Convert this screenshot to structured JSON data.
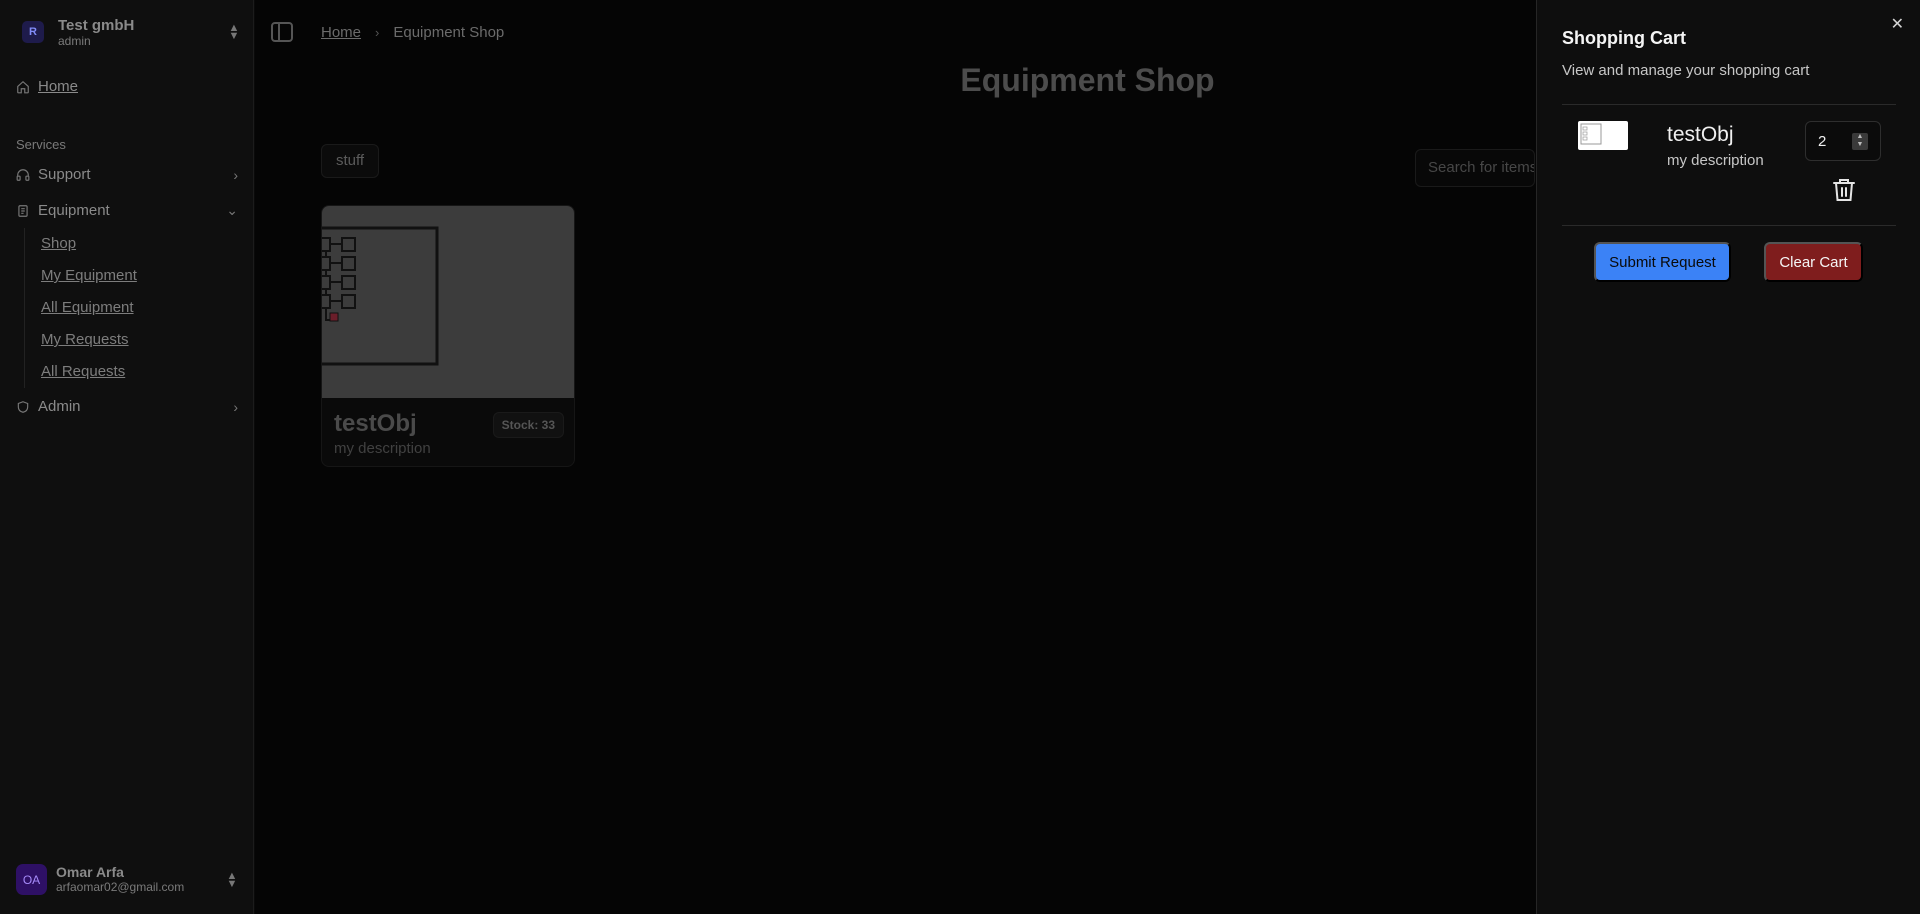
{
  "org": {
    "name": "Test gmbH",
    "role": "admin",
    "logo_letter": "R"
  },
  "nav": {
    "home": "Home",
    "services_label": "Services",
    "support": "Support",
    "equipment": "Equipment",
    "equipment_items": [
      "Shop",
      "My Equipment",
      "All Equipment",
      "My Requests",
      "All Requests"
    ],
    "admin": "Admin"
  },
  "user": {
    "initials": "OA",
    "name": "Omar Arfa",
    "email": "arfaomar02@gmail.com"
  },
  "breadcrumb": {
    "home": "Home",
    "current": "Equipment Shop"
  },
  "page": {
    "title": "Equipment Shop",
    "category": "stuff",
    "search_placeholder": "Search for items"
  },
  "product": {
    "name": "testObj",
    "description": "my description",
    "stock": "Stock: 33"
  },
  "cart": {
    "title": "Shopping Cart",
    "subtitle": "View and manage your shopping cart",
    "items": [
      {
        "name": "testObj",
        "description": "my description",
        "quantity": "2"
      }
    ],
    "submit_label": "Submit Request",
    "clear_label": "Clear Cart"
  },
  "colors": {
    "submit": "#3b82f6",
    "clear": "#7f1d1d",
    "drawer_bg": "#0e0e0e",
    "overlay": "#050505"
  }
}
